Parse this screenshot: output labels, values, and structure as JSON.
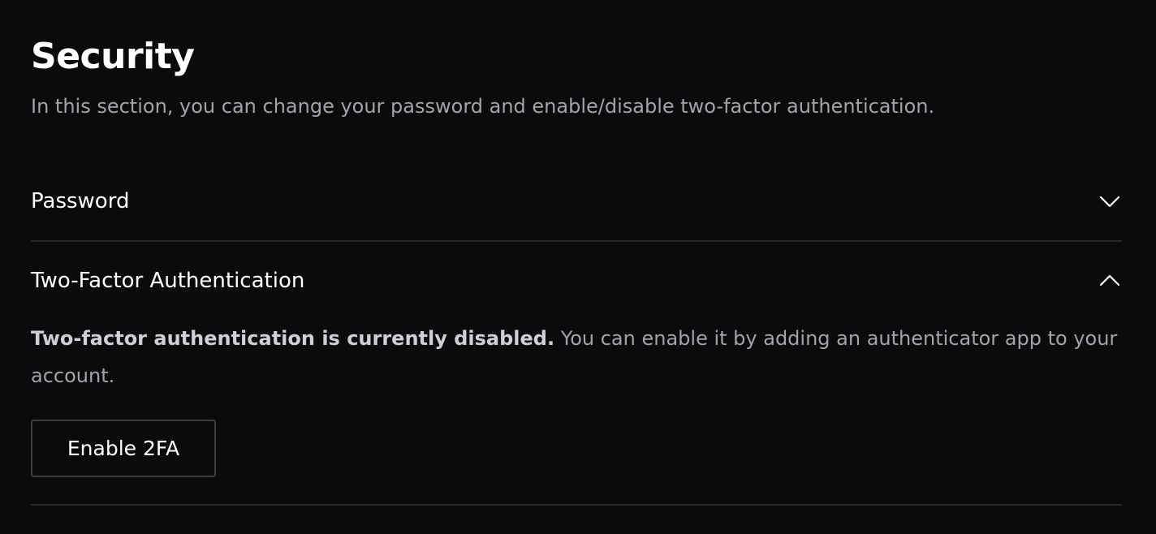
{
  "header": {
    "title": "Security",
    "subtitle": "In this section, you can change your password and enable/disable two-factor authentication."
  },
  "sections": [
    {
      "label": "Password",
      "state": "collapsed",
      "icon": "chevron-down-icon"
    },
    {
      "label": "Two-Factor Authentication",
      "state": "expanded",
      "icon": "chevron-up-icon",
      "status_strong": "Two-factor authentication is currently disabled.",
      "status_text": " You can enable it by adding an authenticator app to your account.",
      "button_label": "Enable 2FA"
    }
  ],
  "colors": {
    "background": "#0b0b0d",
    "text_primary": "#ffffff",
    "text_secondary": "#a3a3a8",
    "divider": "#2a2a2e",
    "button_border": "#3b3b40"
  }
}
